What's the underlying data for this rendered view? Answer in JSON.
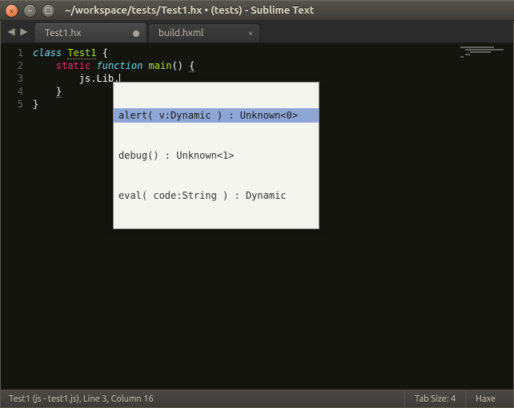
{
  "titlebar": {
    "title": "~/workspace/tests/Test1.hx • (tests) - Sublime Text"
  },
  "tabs": [
    {
      "label": "Test1.hx",
      "active": true,
      "dirty": true
    },
    {
      "label": "build.hxml",
      "active": false,
      "dirty": false
    }
  ],
  "gutter": {
    "lines": [
      "1",
      "2",
      "3",
      "4",
      "5"
    ]
  },
  "code": {
    "l1": {
      "kw_class": "class",
      "name": "Test1",
      "brace_open": " {"
    },
    "l2": {
      "indent": "    ",
      "kw_static": "static",
      "sp1": " ",
      "kw_function": "function",
      "sp2": " ",
      "fn": "main",
      "parens": "()",
      "sp3": " ",
      "brace": "{"
    },
    "l3": {
      "indent": "        ",
      "obj": "js",
      "dot1": ".",
      "prop": "Lib",
      "dot2": "."
    },
    "l4": {
      "indent": "    ",
      "brace": "}"
    },
    "l5": {
      "indent": "",
      "brace": "}"
    }
  },
  "autocomplete": {
    "items": [
      "alert( v:Dynamic ) : Unknown<0>",
      "debug() : Unknown<1>",
      "eval( code:String ) : Dynamic"
    ],
    "selected_index": 0
  },
  "statusbar": {
    "left": "Test1 (js - test1.js), Line 3, Column 16",
    "tabsize": "Tab Size: 4",
    "syntax": "Haxe"
  }
}
